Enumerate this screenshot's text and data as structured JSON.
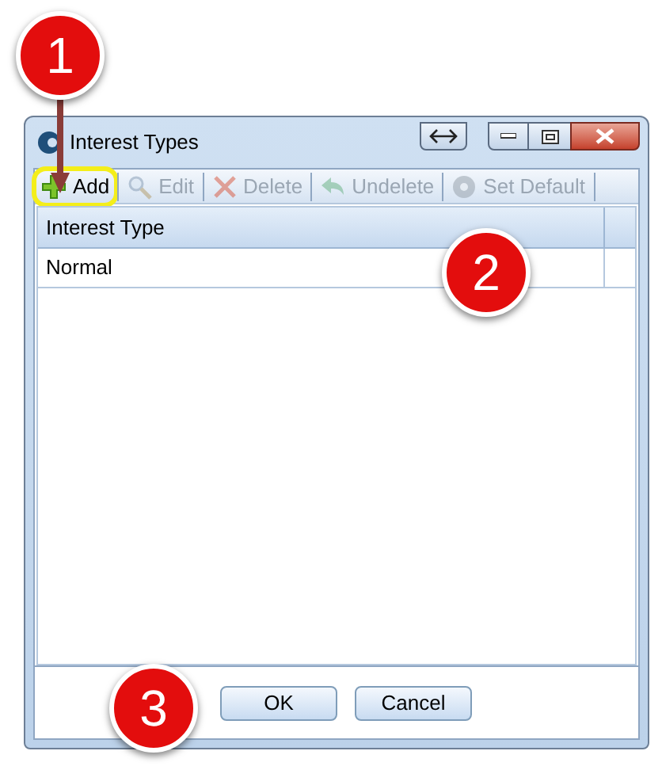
{
  "window": {
    "title": "Interest Types"
  },
  "toolbar": [
    {
      "kind": "add",
      "label": "Add",
      "disabled": false,
      "highlighted": true
    },
    {
      "kind": "edit",
      "label": "Edit",
      "disabled": true,
      "highlighted": false
    },
    {
      "kind": "delete",
      "label": "Delete",
      "disabled": true,
      "highlighted": false
    },
    {
      "kind": "undelete",
      "label": "Undelete",
      "disabled": true,
      "highlighted": false
    },
    {
      "kind": "default",
      "label": "Set Default",
      "disabled": true,
      "highlighted": false
    }
  ],
  "table": {
    "columns": [
      "Interest Type"
    ],
    "rows": [
      [
        "Normal"
      ]
    ]
  },
  "buttons": [
    "OK",
    "Cancel"
  ],
  "callouts": [
    {
      "label": "1",
      "arrow": true
    },
    {
      "label": "2",
      "arrow": false
    },
    {
      "label": "3",
      "arrow": false
    }
  ]
}
